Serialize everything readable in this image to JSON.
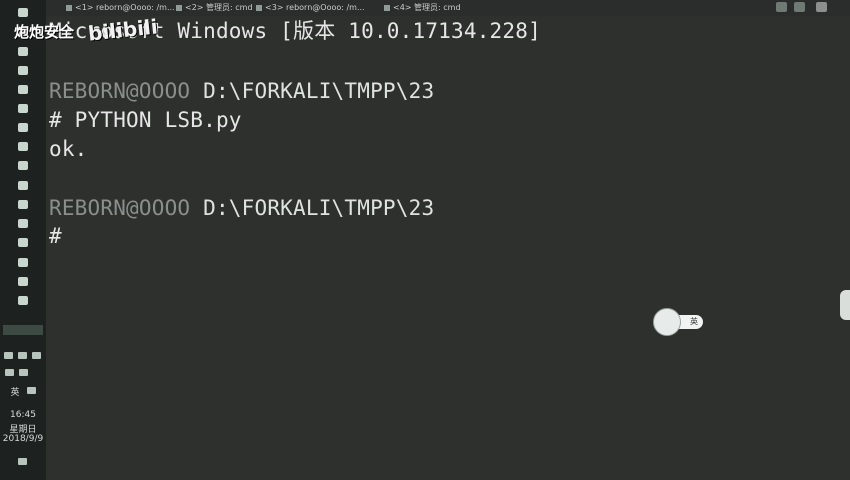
{
  "tabs": [
    {
      "label": "<1> reborn@Oooo: /m..."
    },
    {
      "label": "<2> 管理员: cmd"
    },
    {
      "label": "<3> reborn@Oooo: /m..."
    },
    {
      "label": "<4> 管理员: cmd"
    }
  ],
  "console": {
    "banner": "Microsoft Windows [版本 10.0.17134.228]",
    "prompt1_user": "REBORN@OOOO",
    "prompt1_path": " D:\\FORKALI\\TMPP\\23",
    "command": "# PYTHON LSB.py",
    "output": "ok.",
    "prompt2_user": "REBORN@OOOO",
    "prompt2_path": " D:\\FORKALI\\TMPP\\23",
    "cursor_line": "#"
  },
  "watermark": {
    "text": "炮炮安全",
    "bili": "bilibili"
  },
  "tray": {
    "ime_label": "英",
    "time": "16:45",
    "weekday": "星期日",
    "date": "2018/9/9"
  },
  "ime_indicator": {
    "label": "英"
  },
  "colors": {
    "background": "#2e302e",
    "taskbar": "#1d211f",
    "text": "#e6e6e6"
  }
}
